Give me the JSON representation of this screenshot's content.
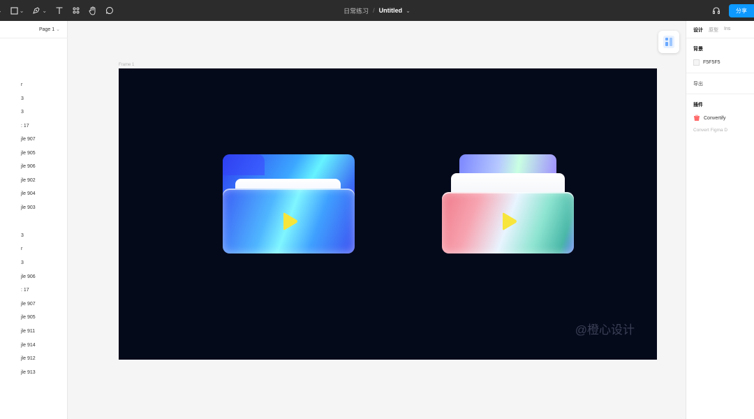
{
  "toolbar": {
    "project": "日常练习",
    "file_title": "Untitled",
    "tools": [
      "move-tool",
      "frame-tool",
      "pen-tool",
      "text-tool",
      "resources-tool",
      "hand-tool",
      "comment-tool"
    ],
    "share_label": "分享"
  },
  "left_panel": {
    "page_label": "Page 1",
    "layers": [
      "r",
      "3",
      "3",
      ": 17",
      "jle 907",
      "jle 905",
      "jle 906",
      "jle 902",
      "jle 904",
      "jle 903",
      "3",
      "r",
      "3",
      "jle 906",
      ": 17",
      "jle 907",
      "jle 905",
      "jle 911",
      "jle 914",
      "jle 912",
      "jle 913"
    ]
  },
  "canvas": {
    "frame_label": "Frame 1",
    "frame_bg": "#050A1B",
    "canvas_bg": "#F5F5F5",
    "watermark": "@橙心设计",
    "play_color": "#F7E53C"
  },
  "right_panel": {
    "tabs": [
      "设计",
      "原型",
      "Ins"
    ],
    "background_heading": "背景",
    "background_value": "F5F5F5",
    "export_label": "导出",
    "plugins_heading": "插件",
    "plugin_name": "Convertify",
    "plugin_desc": "Convert Figma D"
  }
}
